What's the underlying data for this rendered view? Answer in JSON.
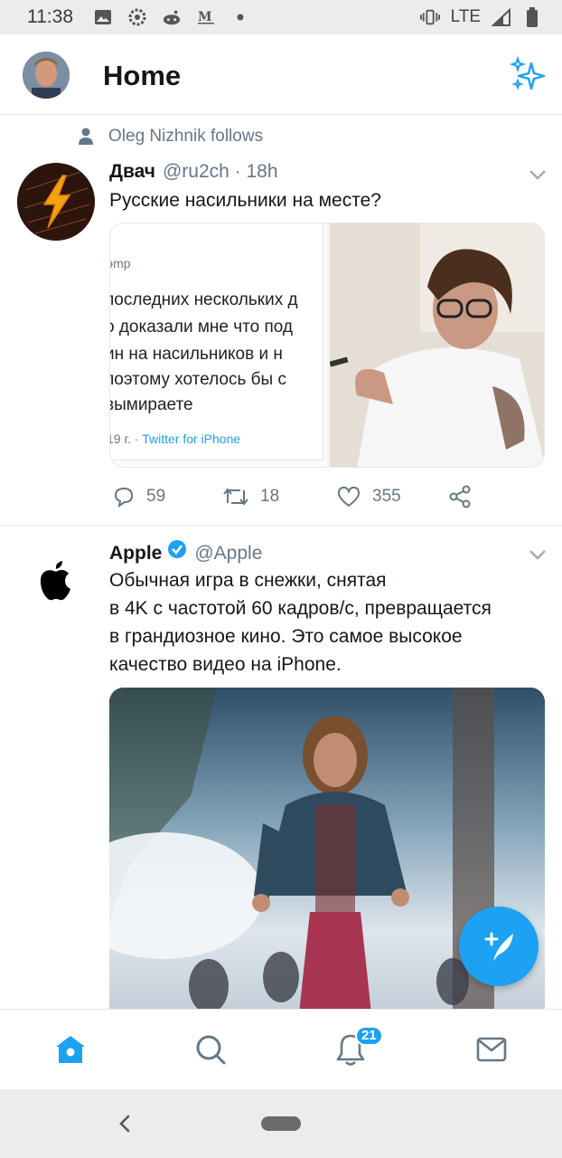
{
  "status_bar": {
    "time": "11:38",
    "network": "LTE",
    "left_icons": [
      "gallery-icon",
      "settings-gear-icon",
      "reddit-icon",
      "gmail-icon",
      "dot-icon"
    ],
    "right_icons": [
      "vibrate-icon",
      "signal-icon",
      "battery-icon"
    ]
  },
  "header": {
    "title": "Home",
    "sparkle_icon": "sparkle-icon"
  },
  "colors": {
    "accent": "#1da1f2",
    "text_primary": "#14171a",
    "text_secondary": "#657786",
    "divider": "#e1e8ed"
  },
  "feed": {
    "tweet1": {
      "social_context": "Oleg Nizhnik follows",
      "name": "Двач",
      "handle": "@ru2ch · 18h",
      "text": "Русские насильники на месте?",
      "media_card": {
        "prefix": "эmp",
        "lines": [
          "последних нескольких д",
          "о доказали мне что под",
          "ин на насильников и н",
          " поэтому хотелось бы с",
          "вымираете"
        ],
        "source_date": "19 г. · ",
        "source_app": "Twitter for iPhone"
      },
      "replies": "59",
      "retweets": "18",
      "likes": "355"
    },
    "tweet2": {
      "name": "Apple",
      "handle": "@Apple",
      "text_lines": [
        "Обычная игра в снежки, снятая",
        "в 4K с частотой 60 кадров/с, превращается",
        "в грандиозное кино. Это самое высокое",
        "качество видео на iPhone."
      ]
    }
  },
  "tab_bar": {
    "home": "home-icon",
    "search": "search-icon",
    "notifications": "bell-icon",
    "notifications_badge": "21",
    "messages": "mail-icon"
  }
}
